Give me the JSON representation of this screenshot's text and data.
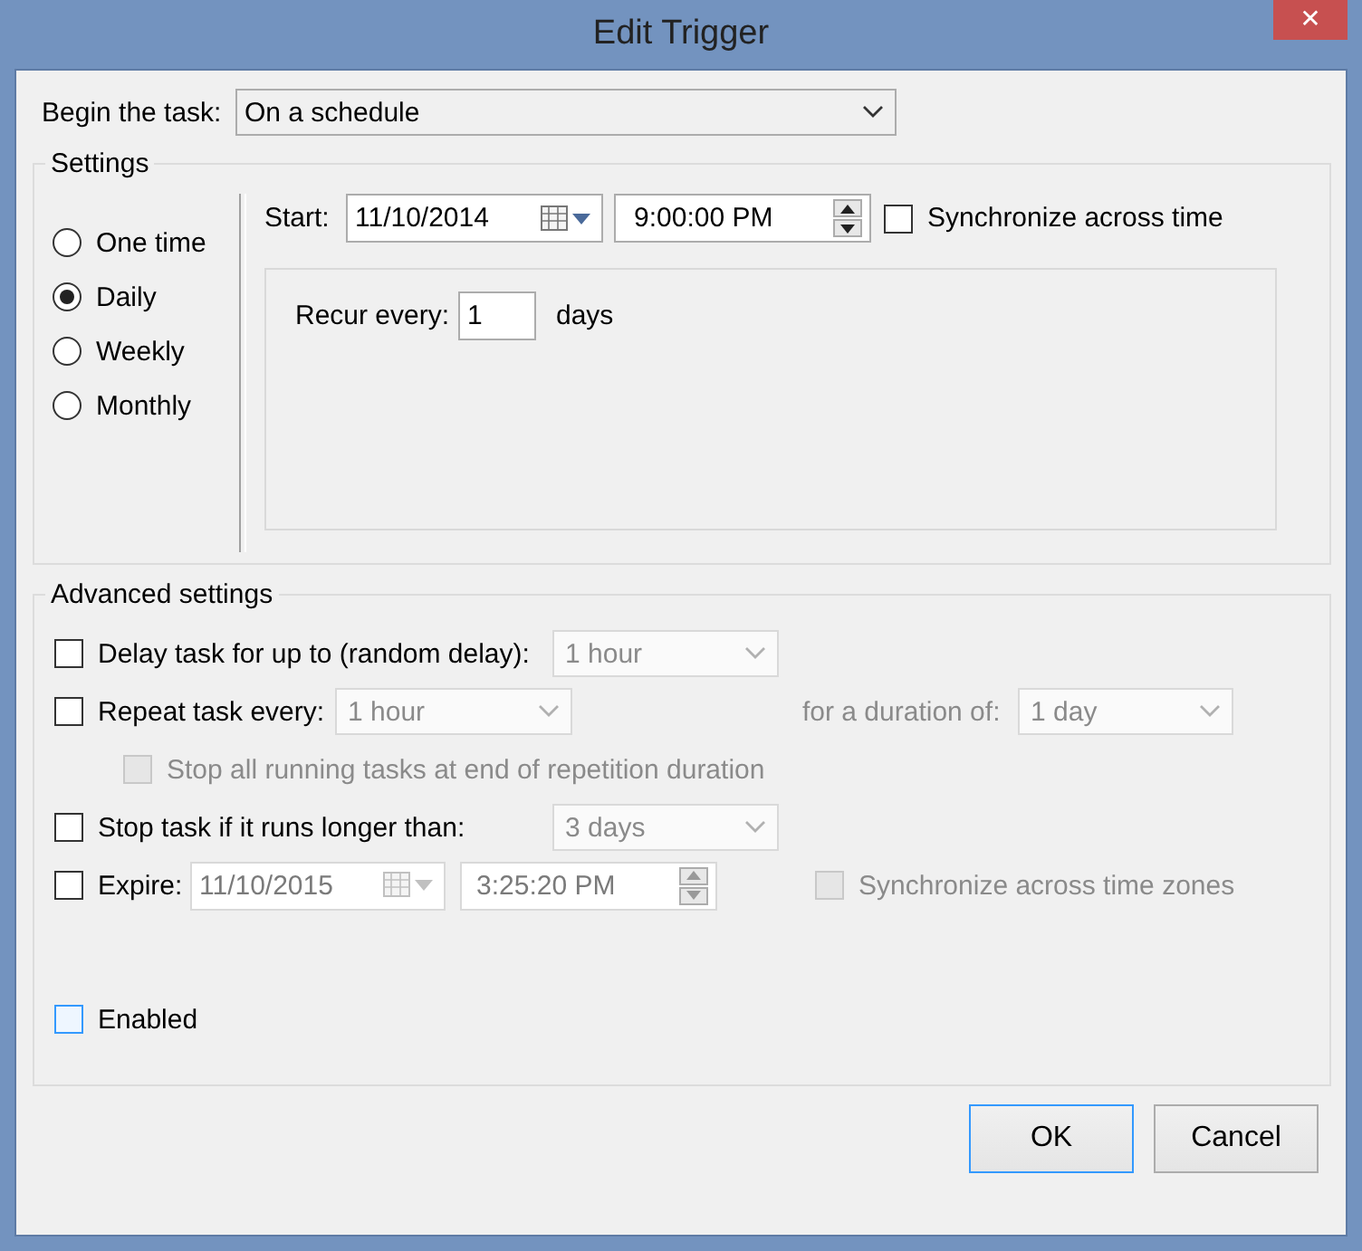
{
  "window": {
    "title": "Edit Trigger",
    "close": "✕"
  },
  "begin_task": {
    "label": "Begin the task:",
    "value": "On a schedule"
  },
  "settings": {
    "title": "Settings",
    "schedule_options": [
      {
        "label": "One time",
        "selected": false
      },
      {
        "label": "Daily",
        "selected": true
      },
      {
        "label": "Weekly",
        "selected": false
      },
      {
        "label": "Monthly",
        "selected": false
      }
    ],
    "start": {
      "label": "Start:",
      "date": "11/10/2014",
      "time": "9:00:00 PM"
    },
    "synchronize": {
      "label": "Synchronize across time",
      "checked": false
    },
    "recur": {
      "label": "Recur every:",
      "value": "1",
      "unit": "days"
    }
  },
  "advanced": {
    "title": "Advanced settings",
    "delay": {
      "label": "Delay task for up to (random delay):",
      "checked": false,
      "value": "1 hour",
      "disabled": true
    },
    "repeat": {
      "label": "Repeat task every:",
      "checked": false,
      "value": "1 hour",
      "disabled": true,
      "duration_label": "for a duration of:",
      "duration_value": "1 day"
    },
    "stop_all": {
      "label": "Stop all running tasks at end of repetition duration",
      "checked": false,
      "disabled": true
    },
    "stop_longer": {
      "label": "Stop task if it runs longer than:",
      "checked": false,
      "value": "3 days",
      "disabled": true
    },
    "expire": {
      "label": "Expire:",
      "checked": false,
      "date": "11/10/2015",
      "time": "3:25:20 PM",
      "disabled": true
    },
    "sync_zones": {
      "label": "Synchronize across time zones",
      "checked": false,
      "disabled": true
    },
    "enabled": {
      "label": "Enabled",
      "checked": false,
      "focused": true
    }
  },
  "buttons": [
    {
      "label": "OK",
      "default": true
    },
    {
      "label": "Cancel",
      "default": false
    }
  ]
}
